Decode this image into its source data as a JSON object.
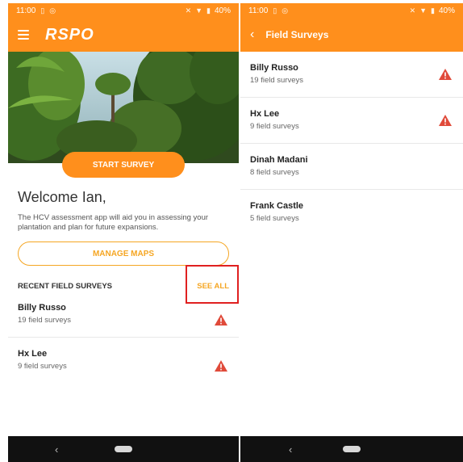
{
  "status": {
    "time": "11:00",
    "battery": "40%"
  },
  "left": {
    "brand": "RSPO",
    "start_survey": "START SURVEY",
    "welcome": "Welcome Ian,",
    "description": "The HCV assessment app will aid you in assessing your plantation and plan for future expansions.",
    "manage_maps": "MANAGE MAPS",
    "recent_title": "RECENT FIELD SURVEYS",
    "see_all": "SEE ALL",
    "surveys": [
      {
        "name": "Billy Russo",
        "count": "19 field surveys",
        "warning": true
      },
      {
        "name": "Hx Lee",
        "count": "9 field surveys",
        "warning": true
      }
    ]
  },
  "right": {
    "title": "Field Surveys",
    "surveys": [
      {
        "name": "Billy Russo",
        "count": "19 field surveys",
        "warning": true
      },
      {
        "name": "Hx Lee",
        "count": "9 field surveys",
        "warning": true
      },
      {
        "name": "Dinah Madani",
        "count": "8 field surveys",
        "warning": false
      },
      {
        "name": "Frank Castle",
        "count": "5 field surveys",
        "warning": false
      }
    ]
  },
  "colors": {
    "accent": "#ff8f1c",
    "warning": "#e04a3a",
    "highlight": "#e02020"
  }
}
